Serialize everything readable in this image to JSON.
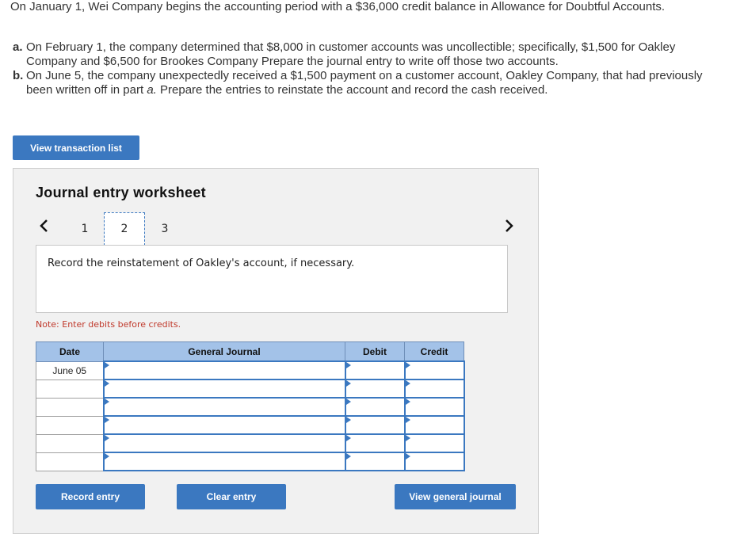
{
  "intro": "On January 1, Wei Company begins the accounting period with a $36,000 credit balance in Allowance for Doubtful Accounts.",
  "parts": {
    "a_label": "a.",
    "a_line1": "On February 1, the company determined that $8,000 in customer accounts was uncollectible; specifically, $1,500 for Oakley",
    "a_line2": "Company and $6,500 for Brookes Company Prepare the journal entry to write off those two accounts.",
    "b_label": "b.",
    "b_line1": "On June 5, the company unexpectedly received a $1,500 payment on a customer account, Oakley Company, that had previously",
    "b_line2_pre": "been written off in part ",
    "b_line2_em": "a.",
    "b_line2_post": " Prepare the entries to reinstate the account and record the cash received."
  },
  "buttons": {
    "view_transactions": "View transaction list",
    "record": "Record entry",
    "clear": "Clear entry",
    "view_journal": "View general journal"
  },
  "worksheet": {
    "title": "Journal entry worksheet",
    "tabs": [
      "1",
      "2",
      "3"
    ],
    "active_tab": "2",
    "prompt": "Record the reinstatement of Oakley's account, if necessary.",
    "note": "Note: Enter debits before credits."
  },
  "journal": {
    "headers": {
      "date": "Date",
      "account": "General Journal",
      "debit": "Debit",
      "credit": "Credit"
    },
    "rows": [
      {
        "date": "June 05",
        "account": "",
        "debit": "",
        "credit": ""
      },
      {
        "date": "",
        "account": "",
        "debit": "",
        "credit": ""
      },
      {
        "date": "",
        "account": "",
        "debit": "",
        "credit": ""
      },
      {
        "date": "",
        "account": "",
        "debit": "",
        "credit": ""
      },
      {
        "date": "",
        "account": "",
        "debit": "",
        "credit": ""
      },
      {
        "date": "",
        "account": "",
        "debit": "",
        "credit": ""
      }
    ]
  },
  "icons": {
    "prev": "chevron-left-icon",
    "next": "chevron-right-icon"
  },
  "colors": {
    "accent": "#3b78c0",
    "header_bg": "#a3c2e8",
    "note": "#c0392b"
  }
}
